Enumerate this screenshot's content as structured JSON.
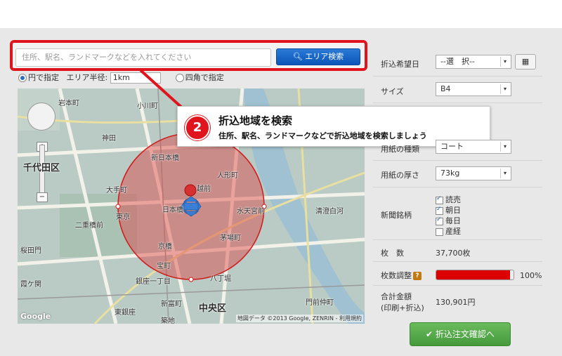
{
  "search": {
    "placeholder": "住所、駅名、ランドマークなどを入れてください",
    "button_label": "エリア検索"
  },
  "area_mode": {
    "option_circle": "円で指定",
    "radius_label": "エリア半径:",
    "radius_value": "1km",
    "option_rect": "四角で指定",
    "selected": "circle"
  },
  "map": {
    "labels": {
      "chiyoda": "千代田区",
      "chuo": "中央区",
      "ogawamachi": "小川町",
      "kandaeki": "神田",
      "nihonbashi_shin": "新日本橋",
      "ningyocho": "人形町",
      "otemachi": "大手町",
      "mitsukoshimae": "越前",
      "nihonbashi": "日本橋",
      "tokyo": "東京",
      "suitengumae": "水天宮前",
      "kiyosumi": "清澄白河",
      "nijubashi": "二重橋前",
      "kayabacho": "茅場町",
      "kyobashi": "京橋",
      "takaracho": "宝町",
      "hatchobori": "八丁堀",
      "sakuradamon": "桜田門",
      "ginza1": "銀座一丁目",
      "kasumigaseki": "霞ケ関",
      "shintomicho": "新富町",
      "higashiginza": "東銀座",
      "tsukiji": "築地",
      "akihabara": "岩本町",
      "monzen": "門前仲町"
    },
    "attribution": "地図データ ©2013 Google, ZENRIN - 利用規約",
    "google_logo": "Google"
  },
  "callout": {
    "number": "2",
    "title": "折込地域を検索",
    "subtitle": "住所、駅名、ランドマークなどで折込地域を検索しましょう"
  },
  "form": {
    "date_label": "折込希望日",
    "date_value": "--選　択--",
    "size_label": "サイズ",
    "size_value": "B4",
    "paper_type_label": "用紙の種類",
    "paper_type_value": "コート",
    "thickness_label": "用紙の厚さ",
    "thickness_value": "73kg",
    "newspaper_label": "新聞銘柄",
    "newspapers": [
      {
        "name": "読売",
        "checked": true
      },
      {
        "name": "朝日",
        "checked": true
      },
      {
        "name": "毎日",
        "checked": true
      },
      {
        "name": "産経",
        "checked": false
      }
    ],
    "count_label": "枚　数",
    "count_value": "37,700枚",
    "adjust_label": "枚数調整",
    "adjust_help": "?",
    "adjust_percent": 100,
    "adjust_percent_text": "100%",
    "total_label_1": "合計金額",
    "total_label_2": "(印刷+折込)",
    "total_value": "130,901円",
    "order_button": "折込注文確認へ"
  },
  "colors": {
    "highlight": "#e0141c",
    "search_button": "#0b55b8",
    "order_button": "#459a3c",
    "adjust_bar": "#dd0000",
    "radius_fill": "#e04040"
  }
}
